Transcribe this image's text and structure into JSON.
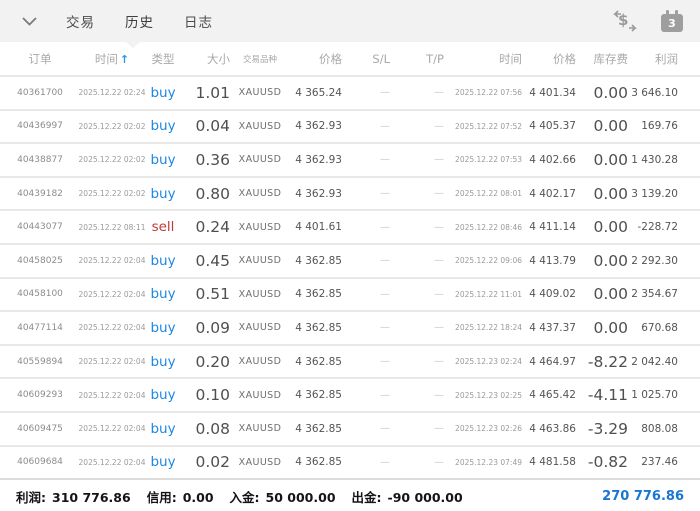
{
  "toolbar": {
    "tabs": [
      {
        "id": "trade",
        "label": "交易",
        "active": false
      },
      {
        "id": "history",
        "label": "历史",
        "active": true
      },
      {
        "id": "journal",
        "label": "日志",
        "active": false
      }
    ],
    "icons": {
      "collapse": "chevron-down",
      "transfer": "dollar-transfer",
      "calendar_badge": "3"
    }
  },
  "table": {
    "headers": [
      "订单",
      "时间",
      "类型",
      "大小",
      "交易品种",
      "价格",
      "S/L",
      "T/P",
      "时间",
      "价格",
      "库存费",
      "利润"
    ],
    "sort": {
      "column_index": 1,
      "direction": "asc"
    },
    "rows": [
      {
        "id": "40361700",
        "open_time": "2025.12.22 02:24",
        "type": "buy",
        "size": "1.01",
        "symbol": "XAUUSD",
        "open_price": "4 365.24",
        "sl": "—",
        "tp": "—",
        "close_time": "2025.12.22 07:56",
        "close_price": "4 401.34",
        "swap": "0.00",
        "profit": "3 646.10"
      },
      {
        "id": "40436997",
        "open_time": "2025.12.22 02:02",
        "type": "buy",
        "size": "0.04",
        "symbol": "XAUUSD",
        "open_price": "4 362.93",
        "sl": "—",
        "tp": "—",
        "close_time": "2025.12.22 07:52",
        "close_price": "4 405.37",
        "swap": "0.00",
        "profit": "169.76"
      },
      {
        "id": "40438877",
        "open_time": "2025.12.22 02:02",
        "type": "buy",
        "size": "0.36",
        "symbol": "XAUUSD",
        "open_price": "4 362.93",
        "sl": "—",
        "tp": "—",
        "close_time": "2025.12.22 07:53",
        "close_price": "4 402.66",
        "swap": "0.00",
        "profit": "1 430.28"
      },
      {
        "id": "40439182",
        "open_time": "2025.12.22 02:02",
        "type": "buy",
        "size": "0.80",
        "symbol": "XAUUSD",
        "open_price": "4 362.93",
        "sl": "—",
        "tp": "—",
        "close_time": "2025.12.22 08:01",
        "close_price": "4 402.17",
        "swap": "0.00",
        "profit": "3 139.20"
      },
      {
        "id": "40443077",
        "open_time": "2025.12.22 08:11",
        "type": "sell",
        "size": "0.24",
        "symbol": "XAUUSD",
        "open_price": "4 401.61",
        "sl": "—",
        "tp": "—",
        "close_time": "2025.12.22 08:46",
        "close_price": "4 411.14",
        "swap": "0.00",
        "profit": "-228.72"
      },
      {
        "id": "40458025",
        "open_time": "2025.12.22 02:04",
        "type": "buy",
        "size": "0.45",
        "symbol": "XAUUSD",
        "open_price": "4 362.85",
        "sl": "—",
        "tp": "—",
        "close_time": "2025.12.22 09:06",
        "close_price": "4 413.79",
        "swap": "0.00",
        "profit": "2 292.30"
      },
      {
        "id": "40458100",
        "open_time": "2025.12.22 02:04",
        "type": "buy",
        "size": "0.51",
        "symbol": "XAUUSD",
        "open_price": "4 362.85",
        "sl": "—",
        "tp": "—",
        "close_time": "2025.12.22 11:01",
        "close_price": "4 409.02",
        "swap": "0.00",
        "profit": "2 354.67"
      },
      {
        "id": "40477114",
        "open_time": "2025.12.22 02:04",
        "type": "buy",
        "size": "0.09",
        "symbol": "XAUUSD",
        "open_price": "4 362.85",
        "sl": "—",
        "tp": "—",
        "close_time": "2025.12.22 18:24",
        "close_price": "4 437.37",
        "swap": "0.00",
        "profit": "670.68"
      },
      {
        "id": "40559894",
        "open_time": "2025.12.22 02:04",
        "type": "buy",
        "size": "0.20",
        "symbol": "XAUUSD",
        "open_price": "4 362.85",
        "sl": "—",
        "tp": "—",
        "close_time": "2025.12.23 02:24",
        "close_price": "4 464.97",
        "swap": "-8.22",
        "profit": "2 042.40"
      },
      {
        "id": "40609293",
        "open_time": "2025.12.22 02:04",
        "type": "buy",
        "size": "0.10",
        "symbol": "XAUUSD",
        "open_price": "4 362.85",
        "sl": "—",
        "tp": "—",
        "close_time": "2025.12.23 02:25",
        "close_price": "4 465.42",
        "swap": "-4.11",
        "profit": "1 025.70"
      },
      {
        "id": "40609475",
        "open_time": "2025.12.22 02:04",
        "type": "buy",
        "size": "0.08",
        "symbol": "XAUUSD",
        "open_price": "4 362.85",
        "sl": "—",
        "tp": "—",
        "close_time": "2025.12.23 02:26",
        "close_price": "4 463.86",
        "swap": "-3.29",
        "profit": "808.08"
      },
      {
        "id": "40609684",
        "open_time": "2025.12.22 02:04",
        "type": "buy",
        "size": "0.02",
        "symbol": "XAUUSD",
        "open_price": "4 362.85",
        "sl": "—",
        "tp": "—",
        "close_time": "2025.12.23 07:49",
        "close_price": "4 481.58",
        "swap": "-0.82",
        "profit": "237.46"
      }
    ]
  },
  "summary": {
    "items": [
      {
        "label": "利润:",
        "value": "310 776.86"
      },
      {
        "label": "信用:",
        "value": "0.00"
      },
      {
        "label": "入金:",
        "value": "50 000.00"
      },
      {
        "label": "出金:",
        "value": "-90 000.00"
      }
    ],
    "total": "270 776.86"
  },
  "colors": {
    "buy": "#1e88e5",
    "sell": "#bf3a32",
    "accent": "#2196f3",
    "total": "#1976d2"
  }
}
